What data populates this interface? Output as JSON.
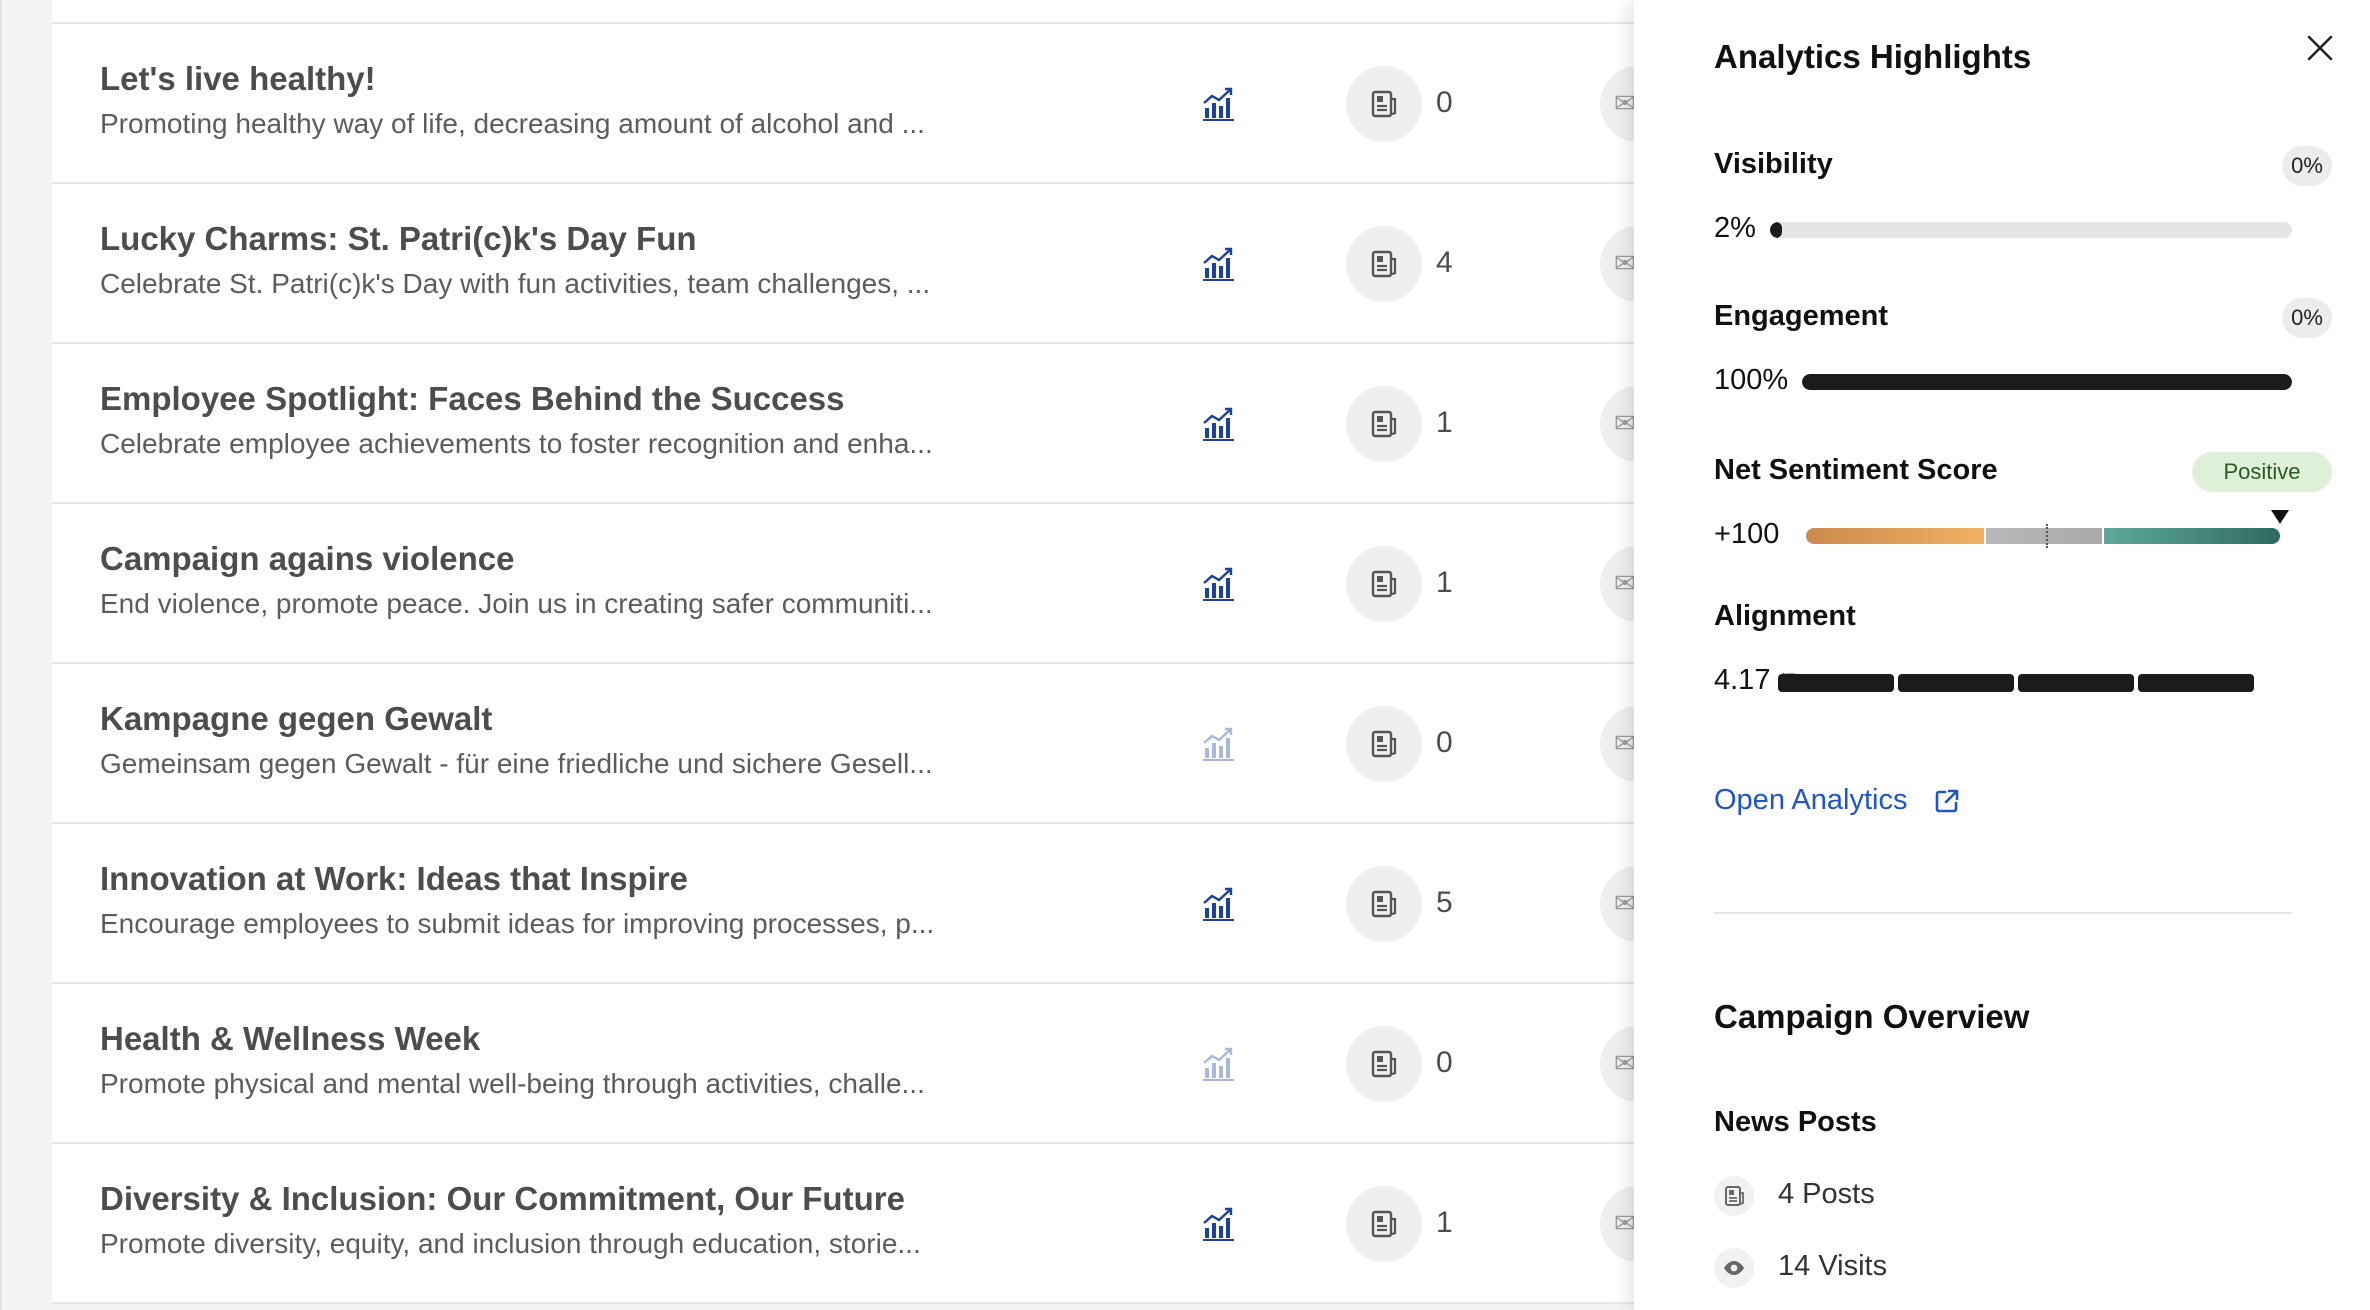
{
  "campaigns": [
    {
      "title": "Let's live healthy!",
      "description": "Promoting healthy way of life, decreasing amount of alcohol and ...",
      "posts": "0",
      "analytics_active": true
    },
    {
      "title": "Lucky Charms: St. Patri(c)k's Day Fun",
      "description": "Celebrate St. Patri(c)k's Day with fun activities, team challenges, ...",
      "posts": "4",
      "analytics_active": true
    },
    {
      "title": "Employee Spotlight: Faces Behind the Success",
      "description": "Celebrate employee achievements to foster recognition and enha...",
      "posts": "1",
      "analytics_active": true
    },
    {
      "title": "Campaign agains violence",
      "description": "End violence, promote peace. Join us in creating safer communiti...",
      "posts": "1",
      "analytics_active": true
    },
    {
      "title": "Kampagne gegen Gewalt",
      "description": "Gemeinsam gegen Gewalt - für eine friedliche und sichere Gesell...",
      "posts": "0",
      "analytics_active": false
    },
    {
      "title": "Innovation at Work: Ideas that Inspire",
      "description": "Encourage employees to submit ideas for improving processes, p...",
      "posts": "5",
      "analytics_active": true
    },
    {
      "title": "Health & Wellness Week",
      "description": "Promote physical and mental well-being through activities, challe...",
      "posts": "0",
      "analytics_active": false
    },
    {
      "title": "Diversity & Inclusion: Our Commitment, Our Future",
      "description": "Promote diversity, equity, and inclusion through education, storie...",
      "posts": "1",
      "analytics_active": true
    }
  ],
  "drawer": {
    "title": "Analytics Highlights",
    "visibility": {
      "label": "Visibility",
      "value": "2%",
      "badge": "0%",
      "fraction": 0.02
    },
    "engagement": {
      "label": "Engagement",
      "value": "100%",
      "badge": "0%",
      "fraction": 1.0
    },
    "sentiment": {
      "label": "Net Sentiment Score",
      "value": "+100",
      "badge": "Positive",
      "score": 100
    },
    "alignment": {
      "label": "Alignment",
      "value": "4.17",
      "suffix": "/5",
      "score": 4.17,
      "max": 5
    },
    "open_analytics": "Open Analytics",
    "overview_title": "Campaign Overview",
    "news_posts_title": "News Posts",
    "posts_count": "4 Posts",
    "visits_count": "14 Visits"
  },
  "colors": {
    "link": "#1f55c4",
    "chart_icon_active": "#1d3f9e",
    "chart_icon_inactive": "#a9b8da",
    "positive_badge": "#dff0d8"
  },
  "icons": {
    "close": "close-icon",
    "chart": "bar-chart-icon",
    "posts": "newspaper-icon",
    "visits": "eye-icon",
    "external": "external-link-icon"
  }
}
